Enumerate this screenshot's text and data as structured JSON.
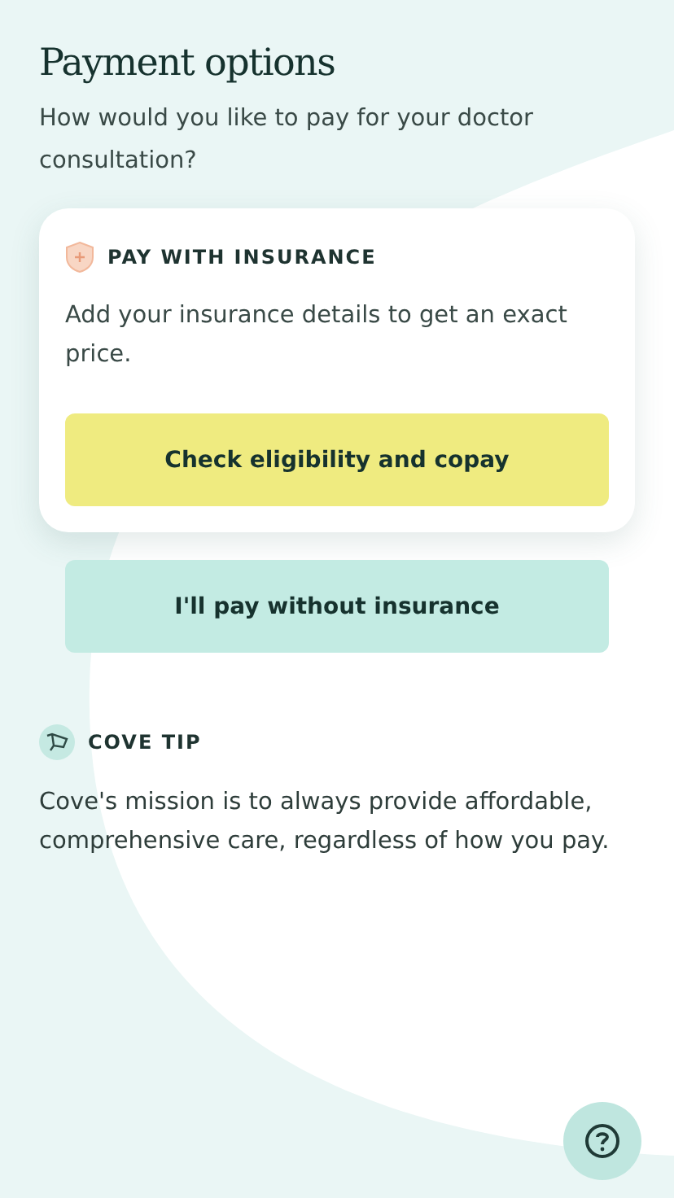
{
  "title": "Payment options",
  "subtitle": "How would you like to pay for your doctor consultation?",
  "insurance_card": {
    "label": "PAY WITH INSURANCE",
    "description": "Add your insurance details to get an exact price.",
    "button": "Check eligibility and copay"
  },
  "secondary_button": "I'll pay without insurance",
  "tip": {
    "label": "COVE TIP",
    "text": "Cove's mission is to always provide affordable, comprehensive care, regardless of how you pay."
  }
}
